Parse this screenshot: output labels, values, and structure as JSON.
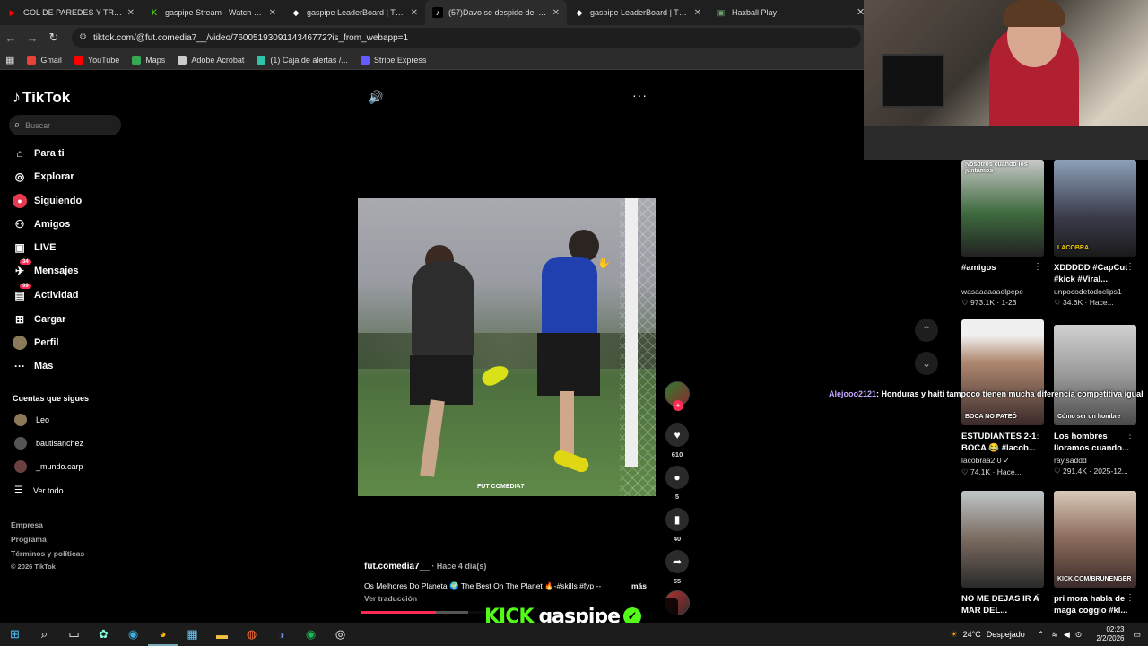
{
  "browser": {
    "tabs": [
      {
        "title": "GOL DE PAREDES Y TRIUNFAZO",
        "favicon": "youtube-icon",
        "color": "#ff0000"
      },
      {
        "title": "gaspipe Stream - Watch Live on",
        "favicon": "kick-icon",
        "color": "#53fc18"
      },
      {
        "title": "gaspipe LeaderBoard | The best",
        "favicon": "diamond-icon",
        "color": "#ffffff"
      },
      {
        "title": "(57)Davo se despide del stream",
        "favicon": "tiktok-icon",
        "color": "#ffffff"
      },
      {
        "title": "gaspipe LeaderBoard | The best",
        "favicon": "diamond-icon",
        "color": "#ffffff"
      },
      {
        "title": "Haxball Play",
        "favicon": "haxball-icon",
        "color": "#6fa36f"
      }
    ],
    "url": "tiktok.com/@fut.comedia7__/video/7600519309114346772?is_from_webapp=1",
    "bookmarks": [
      {
        "label": "Gmail",
        "color": "#ea4335"
      },
      {
        "label": "YouTube",
        "color": "#ff0000"
      },
      {
        "label": "Maps",
        "color": "#34a853"
      },
      {
        "label": "Adobe Acrobat",
        "color": "#cccccc"
      },
      {
        "label": "(1) Caja de alertas /...",
        "color": "#2ec4a7"
      },
      {
        "label": "Stripe Express",
        "color": "#635bff"
      }
    ]
  },
  "tiktok": {
    "logo": "TikTok",
    "search_placeholder": "Buscar",
    "menu": [
      {
        "label": "Para ti",
        "icon": "home-icon",
        "glyph": "⌂"
      },
      {
        "label": "Explorar",
        "icon": "compass-icon",
        "glyph": "◎"
      },
      {
        "label": "Siguiendo",
        "icon": "following-icon",
        "glyph": "●"
      },
      {
        "label": "Amigos",
        "icon": "friends-icon",
        "glyph": "⚇"
      },
      {
        "label": "LIVE",
        "icon": "live-icon",
        "glyph": "▣"
      },
      {
        "label": "Mensajes",
        "icon": "messages-icon",
        "glyph": "✈",
        "badge": "34"
      },
      {
        "label": "Actividad",
        "icon": "activity-icon",
        "glyph": "▤",
        "badge": "99"
      },
      {
        "label": "Cargar",
        "icon": "upload-icon",
        "glyph": "⊞"
      },
      {
        "label": "Perfil",
        "icon": "profile-icon",
        "glyph": "●"
      },
      {
        "label": "Más",
        "icon": "more-icon",
        "glyph": "···"
      }
    ],
    "following_title": "Cuentas que sigues",
    "following": [
      {
        "name": "Leo",
        "color": "#8a7a5a"
      },
      {
        "name": "bautisanchez",
        "color": "#555555"
      },
      {
        "name": "_mundo.carp",
        "color": "#6a4040"
      }
    ],
    "see_all": "Ver todo",
    "footer": [
      "Empresa",
      "Programa",
      "Términos y políticas"
    ],
    "copyright": "© 2026 TikTok"
  },
  "video": {
    "watermark": "FUT COMEDIA7",
    "author": "fut.comedia7__",
    "time": " · Hace 4 día(s)",
    "description": "Os Melhores Do Planeta  🌍 The Best On The Planet 🔥-#skills #fyp --",
    "more": "más",
    "translate": "Ver traducción",
    "progress": 0.55,
    "likes": "610",
    "comments": "5",
    "saves": "40",
    "shares": "55"
  },
  "kick_overlay": {
    "logo": "KICK",
    "name": "gaspipe"
  },
  "chat": {
    "user": "Alejooo2121",
    "message": ": Honduras y haiti tampoco tienen mucha diferencia competitiva igual"
  },
  "recommended": [
    {
      "title": "#amigos",
      "user": "wasaaaaaaelpepe",
      "meta": "♡ 973.1K · 1-23",
      "overlay": "Nosotros cuando los juntamos",
      "bg": "linear-gradient(180deg,#c8c8c8,#3e6b3e 55%,#222)"
    },
    {
      "title": "XDDDDD #CapCut #kick #Viral...",
      "user": "unpocodetodoclips1",
      "meta": "♡ 34.6K · Hace...",
      "overlay": "LACOBRA",
      "bg": "linear-gradient(180deg,#8da0b8,#3a3a4a 60%,#1a1a1a)"
    },
    {
      "title": "ESTUDIANTES 2-1 BOCA 😂 #lacob...",
      "user": "lacobraa2.0 ✓",
      "meta": "♡ 74.1K · Hace...",
      "overlay": "BOCA NO PATEÓ",
      "bg": "linear-gradient(180deg,#f0f0f0 15%,#b08870 40%,#3a2a2a)"
    },
    {
      "title": "Los hombres lloramos cuando...",
      "user": "ray.saddd",
      "meta": "♡ 291.4K · 2025-12...",
      "overlay": "Cómo ser un hombre",
      "bg": "linear-gradient(180deg,#d0d0d0,#9a9a9a 50%,#4a4a4a)"
    },
    {
      "title": "NO ME DEJAS IR A MAR DEL...",
      "user": "",
      "meta": "",
      "overlay": "",
      "bg": "linear-gradient(180deg,#bfc6c8,#7a6a60 50%,#2a2a2a)"
    },
    {
      "title": "pri mora habla de maga coggio #kl...",
      "user": "",
      "meta": "",
      "overlay": "KICK.COM/BRUNENGER",
      "bg": "linear-gradient(180deg,#d8c8b8,#8a6a5a 50%,#3a2a2a)"
    }
  ],
  "taskbar": {
    "temp": "24°C",
    "weather": "Despejado",
    "time": "02:23",
    "date": "2/2/2026"
  }
}
